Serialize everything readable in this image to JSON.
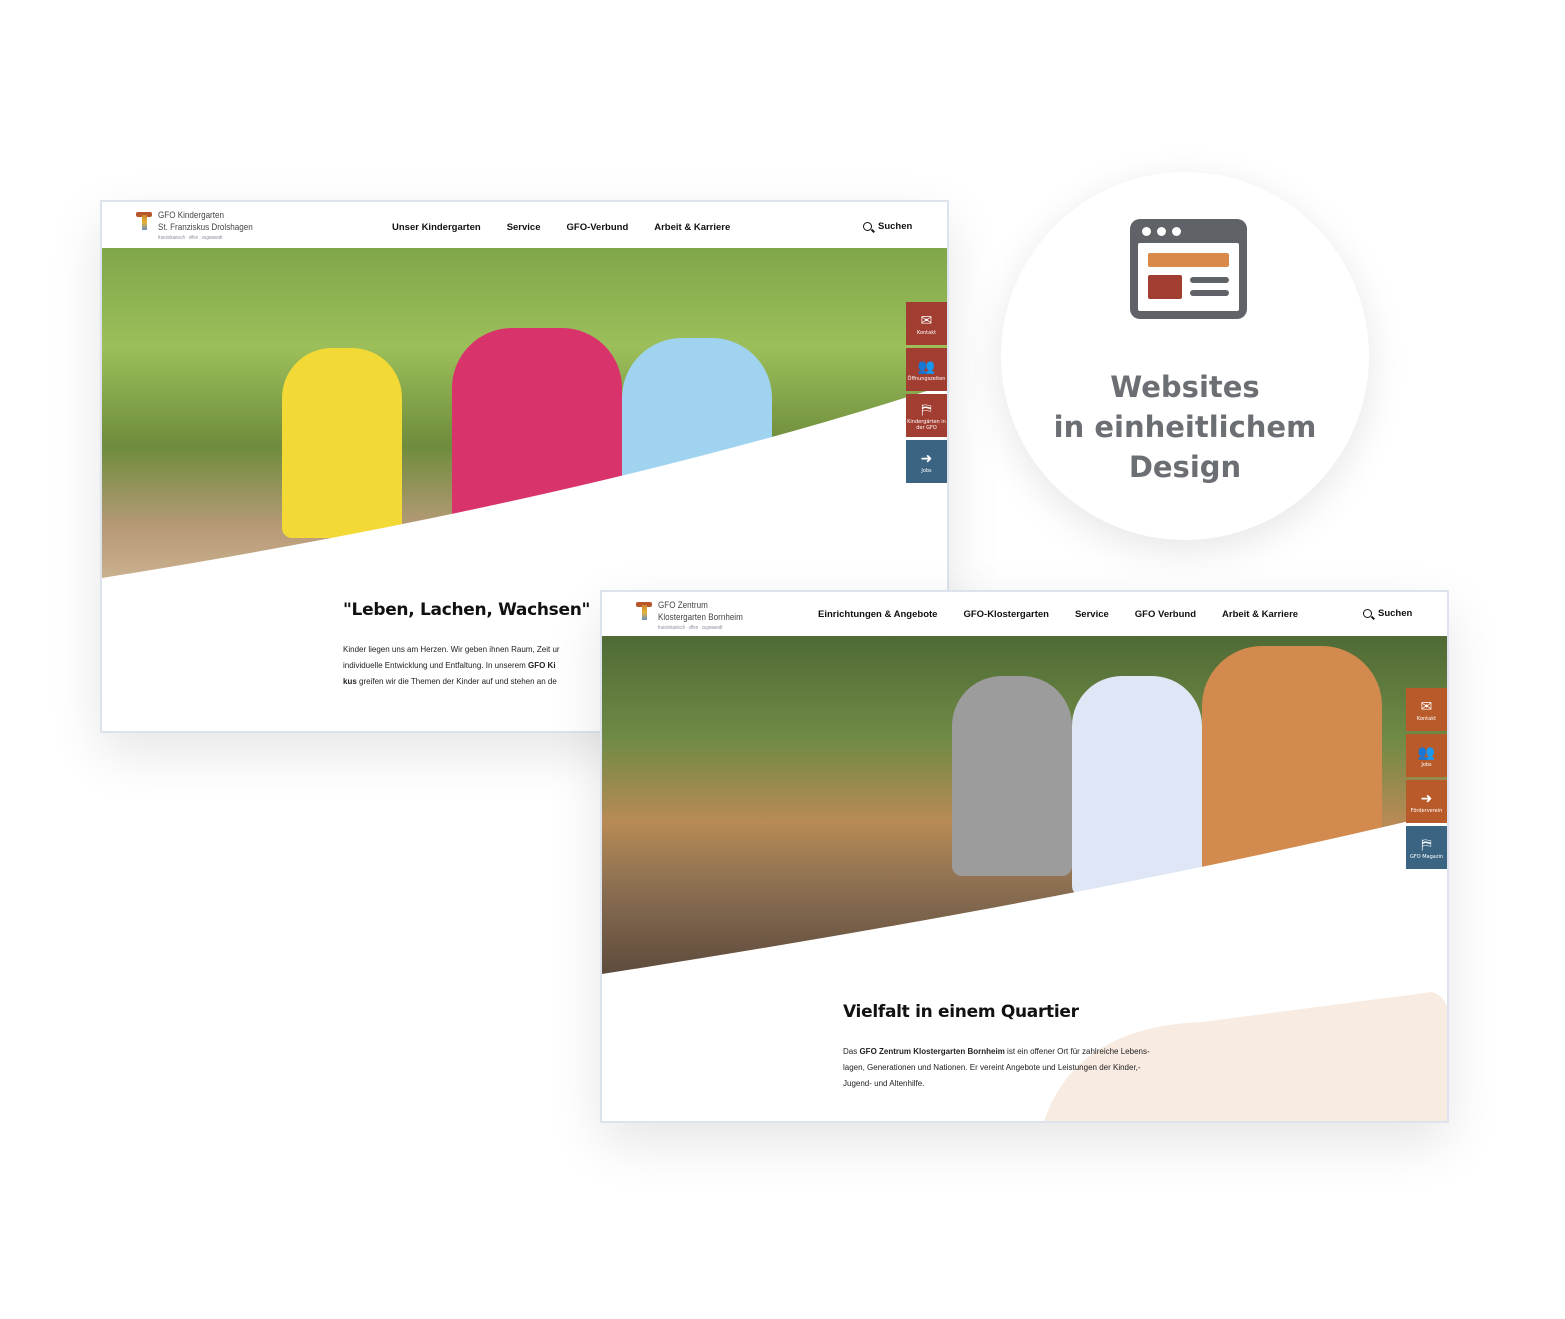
{
  "site1": {
    "logo": {
      "name": "GFO Kindergarten",
      "subtitle": "St. Franziskus Drolshagen",
      "tagline": "franziskanisch · offen · zugewandt"
    },
    "nav": [
      "Unser Kindergarten",
      "Service",
      "GFO-Verbund",
      "Arbeit & Karriere"
    ],
    "search": "Suchen",
    "sidebar": [
      {
        "label": "Kontakt",
        "icon": "contact-icon"
      },
      {
        "label": "Öffnungszeiten",
        "icon": "people-icon"
      },
      {
        "label": "Kindergärten in der GFO",
        "icon": "map-icon"
      },
      {
        "label": "Jobs",
        "icon": "sign-in-icon"
      }
    ],
    "sidebar_colors": [
      "#a23e31",
      "#a23e31",
      "#a23e31",
      "#3b6483"
    ],
    "heading": "\"Leben, Lachen, Wachsen\"",
    "text": {
      "p1": "Kinder liegen uns am Herzen. Wir geben ihnen Raum, Zeit ur",
      "p2a": "individuelle Entwicklung und Entfaltung. In unserem ",
      "p2b": "GFO Ki",
      "p3a": "kus",
      "p3b": " greifen wir die Themen der Kinder auf und stehen an de"
    }
  },
  "site2": {
    "logo": {
      "name": "GFO Zentrum",
      "subtitle": "Klostergarten Bornheim",
      "tagline": "franziskanisch · offen · zugewandt"
    },
    "nav": [
      "Einrichtungen & Angebote",
      "GFO-Klostergarten",
      "Service",
      "GFO Verbund",
      "Arbeit & Karriere"
    ],
    "search": "Suchen",
    "sidebar": [
      {
        "label": "Kontakt",
        "icon": "contact-icon"
      },
      {
        "label": "Jobs",
        "icon": "people-icon"
      },
      {
        "label": "Förderverein",
        "icon": "sign-in-icon"
      },
      {
        "label": "GFO Magazin",
        "icon": "map-icon"
      }
    ],
    "heading": "Vielfalt in einem Quartier",
    "text": {
      "p1a": "Das ",
      "p1b": "GFO Zentrum Klostergarten Bornheim",
      "p1c": " ist ein offener Ort für zahlreiche Lebens-",
      "p2": "lagen, Generationen und Nationen. Er vereint Angebote und Leistungen der Kinder,-",
      "p3": "Jugend- und Altenhilfe."
    }
  },
  "badge": {
    "line1": "Websites",
    "line2": "in einheitlichem",
    "line3": "Design",
    "icon": "browser-layout-icon"
  },
  "colors": {
    "red": "#a23e31",
    "orange": "#b85a2a",
    "blue": "#3b6483",
    "gray": "#6b6e72"
  }
}
